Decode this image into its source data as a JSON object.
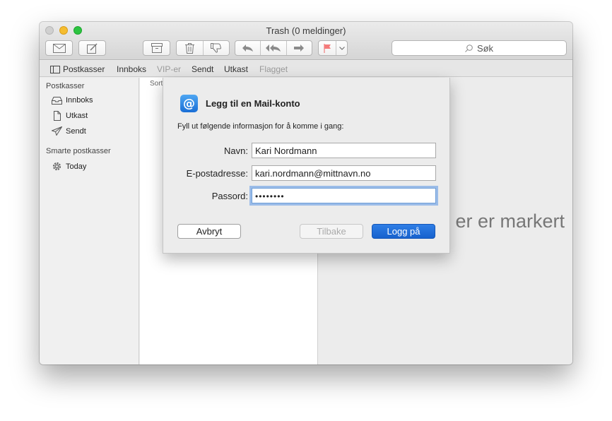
{
  "window": {
    "title": "Trash (0 meldinger)"
  },
  "toolbar": {
    "search_label": "Søk",
    "buttons": [
      "get-mail",
      "compose",
      "archive",
      "delete",
      "junk",
      "reply",
      "reply-all",
      "forward",
      "flag",
      "flag-menu"
    ],
    "flag_color": "#f47b7b"
  },
  "favorites": {
    "mailboxes_toggle": "Postkasser",
    "items": [
      "Innboks",
      "VIP-er",
      "Sendt",
      "Utkast",
      "Flagget"
    ]
  },
  "sidebar": {
    "mailboxes_heading": "Postkasser",
    "items": [
      {
        "label": "Innboks",
        "icon": "inbox-icon"
      },
      {
        "label": "Utkast",
        "icon": "draft-icon"
      },
      {
        "label": "Sendt",
        "icon": "sent-icon"
      }
    ],
    "smart_heading": "Smarte postkasser",
    "smart_items": [
      {
        "label": "Today",
        "icon": "gear-icon"
      }
    ]
  },
  "message_list": {
    "sort_label": "Sort"
  },
  "preview": {
    "empty_text": "er er markert"
  },
  "dialog": {
    "title": "Legg til en Mail-konto",
    "intro": "Fyll ut følgende informasjon for å komme i gang:",
    "name_label": "Navn:",
    "name_value": "Kari Nordmann",
    "email_label": "E-postadresse:",
    "email_value": "kari.nordmann@mittnavn.no",
    "password_label": "Passord:",
    "password_mask": "••••••••",
    "cancel_label": "Avbryt",
    "back_label": "Tilbake",
    "login_label": "Logg på",
    "accent_color": "#1b66d2"
  }
}
